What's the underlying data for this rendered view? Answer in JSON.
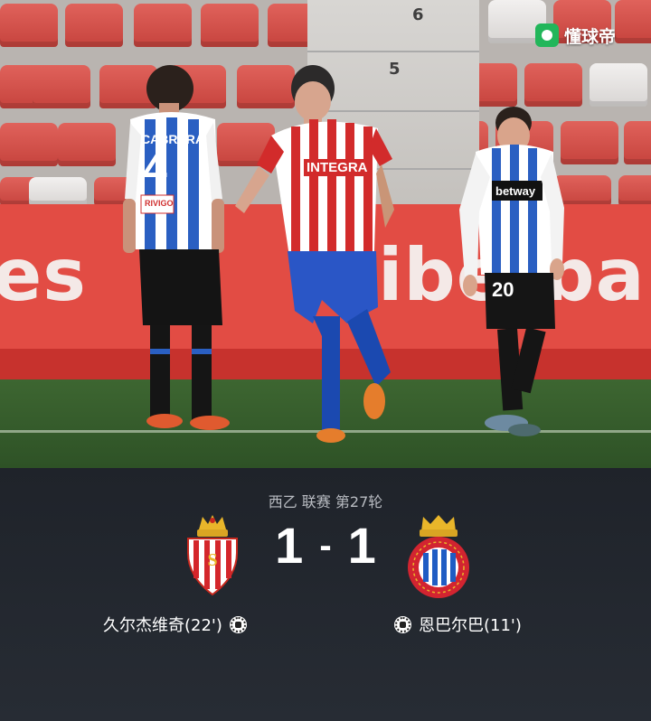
{
  "watermark": {
    "text": "懂球帝",
    "icon": "dongqiudi-logo-icon"
  },
  "photo": {
    "stand_numbers": [
      "6",
      "5"
    ],
    "ad_left": "es",
    "ad_right": "iberban",
    "players": {
      "left": {
        "name": "CABRERA",
        "number": "4",
        "sponsor": "RIVIGO"
      },
      "center": {
        "sponsor": "INTEGRA"
      },
      "right": {
        "number": "20",
        "sponsor": "betway"
      }
    }
  },
  "match": {
    "competition": "西乙 联赛 第27轮",
    "home_score": "1",
    "separator": "-",
    "away_score": "1",
    "home_crest": "sporting-gijon-crest-icon",
    "away_crest": "espanyol-crest-icon",
    "home_scorer": "久尔杰维奇(22')",
    "away_scorer": "恩巴尔巴(11')",
    "goal_icon": "soccer-ball-icon"
  },
  "colors": {
    "panel_bg": "#1f232a",
    "home_red": "#d42a2a",
    "away_blue": "#1f5cc4",
    "watermark_green": "#22b65a"
  }
}
